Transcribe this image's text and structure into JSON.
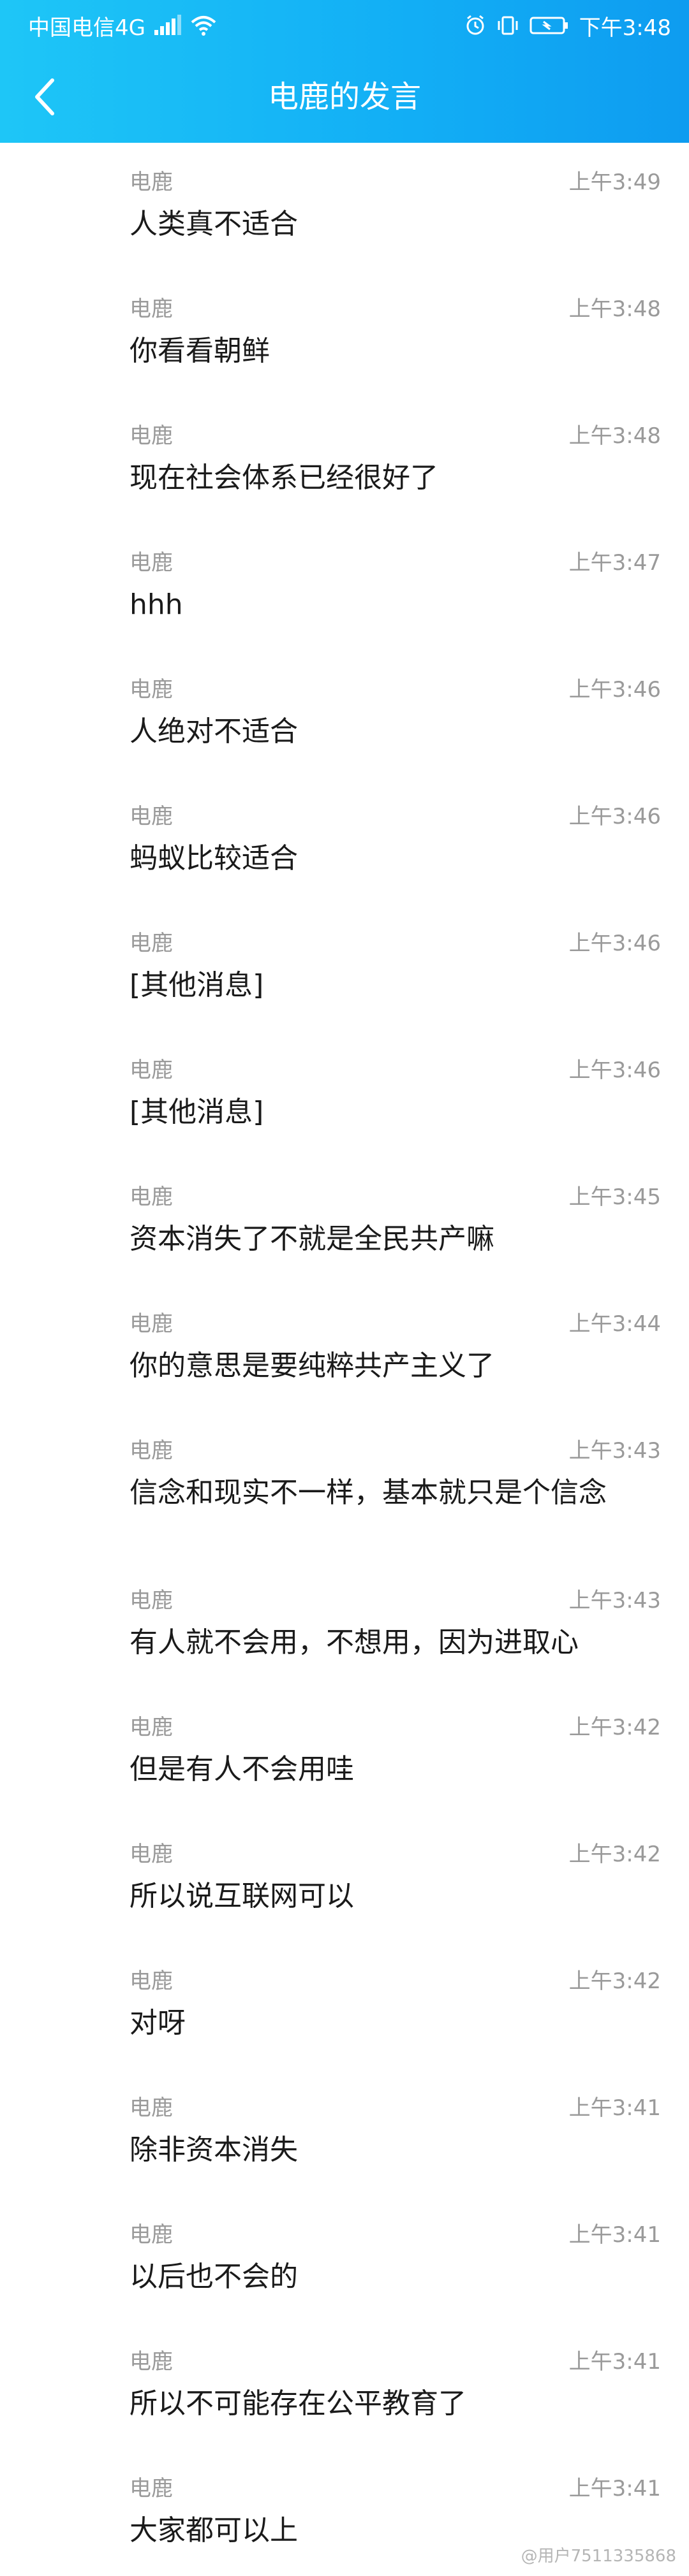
{
  "status": {
    "carrier": "中国电信4G",
    "time": "下午3:48"
  },
  "header": {
    "title": "电鹿的发言"
  },
  "messages": [
    {
      "sender": "电鹿",
      "time": "上午3:49",
      "text": "人类真不适合"
    },
    {
      "sender": "电鹿",
      "time": "上午3:48",
      "text": "你看看朝鲜"
    },
    {
      "sender": "电鹿",
      "time": "上午3:48",
      "text": "现在社会体系已经很好了"
    },
    {
      "sender": "电鹿",
      "time": "上午3:47",
      "text": "hhh"
    },
    {
      "sender": "电鹿",
      "time": "上午3:46",
      "text": "人绝对不适合"
    },
    {
      "sender": "电鹿",
      "time": "上午3:46",
      "text": "蚂蚁比较适合"
    },
    {
      "sender": "电鹿",
      "time": "上午3:46",
      "text": "[其他消息]"
    },
    {
      "sender": "电鹿",
      "time": "上午3:46",
      "text": "[其他消息]"
    },
    {
      "sender": "电鹿",
      "time": "上午3:45",
      "text": "资本消失了不就是全民共产嘛"
    },
    {
      "sender": "电鹿",
      "time": "上午3:44",
      "text": "你的意思是要纯粹共产主义了"
    },
    {
      "sender": "电鹿",
      "time": "上午3:43",
      "text": "信念和现实不一样，基本就只是个信念"
    },
    {
      "sender": "电鹿",
      "time": "上午3:43",
      "text": "有人就不会用，不想用，因为进取心"
    },
    {
      "sender": "电鹿",
      "time": "上午3:42",
      "text": "但是有人不会用哇"
    },
    {
      "sender": "电鹿",
      "time": "上午3:42",
      "text": "所以说互联网可以"
    },
    {
      "sender": "电鹿",
      "time": "上午3:42",
      "text": "对呀"
    },
    {
      "sender": "电鹿",
      "time": "上午3:41",
      "text": "除非资本消失"
    },
    {
      "sender": "电鹿",
      "time": "上午3:41",
      "text": "以后也不会的"
    },
    {
      "sender": "电鹿",
      "time": "上午3:41",
      "text": "所以不可能存在公平教育了"
    },
    {
      "sender": "电鹿",
      "time": "上午3:41",
      "text": "大家都可以上"
    }
  ],
  "watermark": "@用户7511335868"
}
